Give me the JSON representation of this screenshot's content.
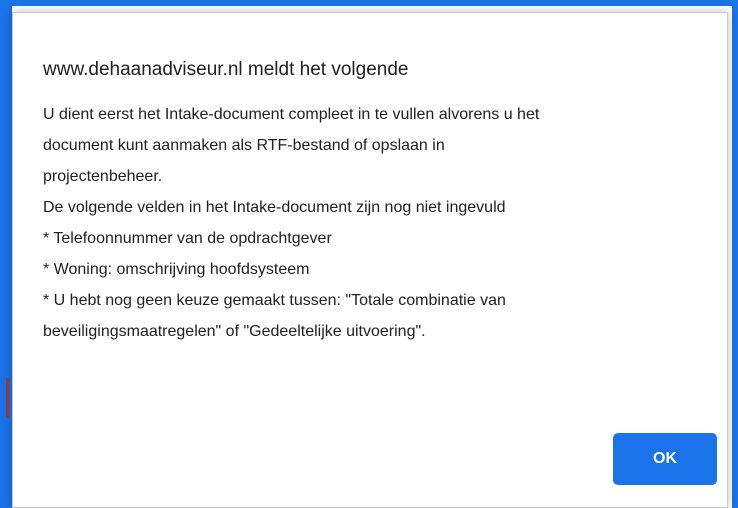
{
  "dialog": {
    "title": "www.dehaanadviseur.nl meldt het volgende",
    "message_lines": [
      "U dient eerst het Intake-document compleet in te vullen alvorens u het",
      "document kunt aanmaken als RTF-bestand of opslaan in",
      "projectenbeheer.",
      "De volgende velden in het Intake-document zijn nog niet ingevuld",
      "* Telefoonnummer van de opdrachtgever",
      "* Woning: omschrijving hoofdsysteem",
      "* U hebt nog geen keuze gemaakt tussen: \"Totale combinatie van",
      "beveiligingsmaatregelen\" of \"Gedeeltelijke uitvoering\"."
    ],
    "ok_label": "OK"
  },
  "colors": {
    "accent": "#1a73e8",
    "text": "#202124",
    "background": "#ffffff"
  }
}
